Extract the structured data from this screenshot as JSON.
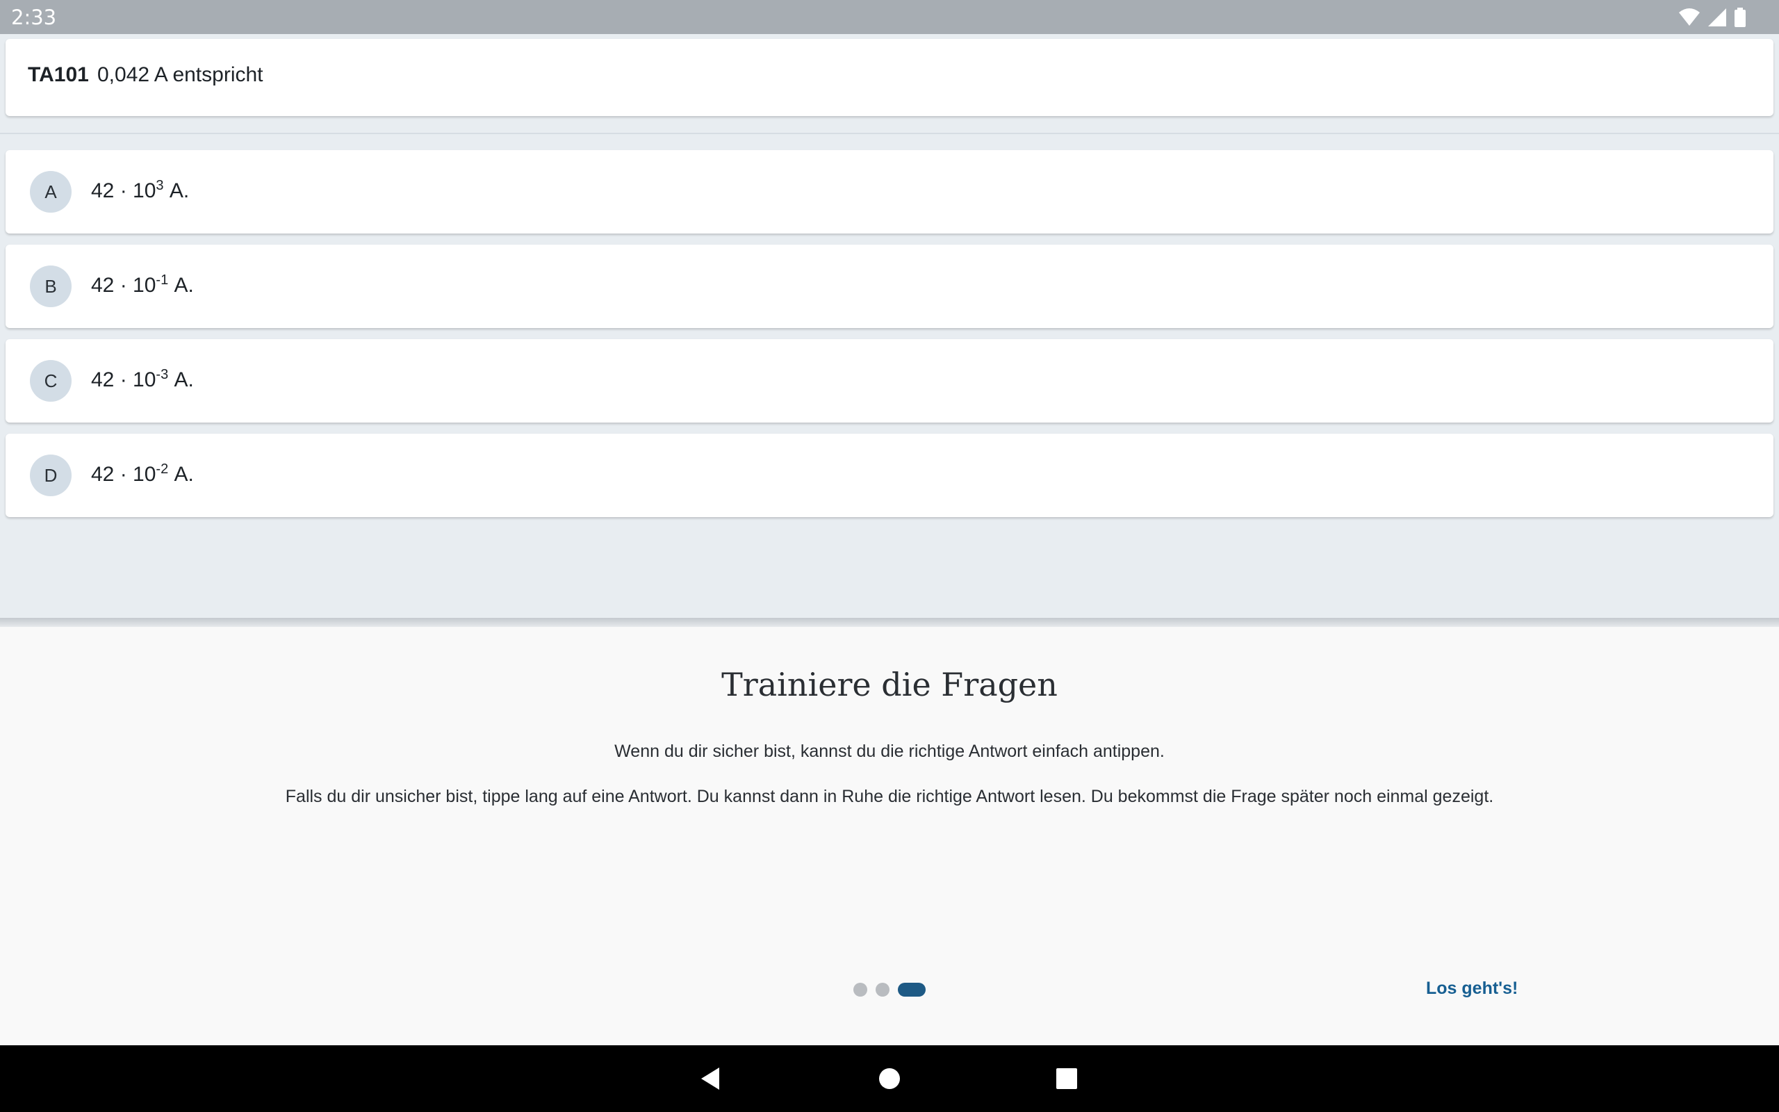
{
  "status_bar": {
    "time": "2:33",
    "icons": [
      "wifi-icon",
      "signal-icon",
      "battery-icon"
    ]
  },
  "question": {
    "id": "TA101",
    "text": "0,042 A entspricht"
  },
  "answers": [
    {
      "letter": "A",
      "base": "42 · 10",
      "exponent": "3",
      "unit": "A."
    },
    {
      "letter": "B",
      "base": "42 · 10",
      "exponent": "-1",
      "unit": "A."
    },
    {
      "letter": "C",
      "base": "42 · 10",
      "exponent": "-3",
      "unit": "A."
    },
    {
      "letter": "D",
      "base": "42 · 10",
      "exponent": "-2",
      "unit": "A."
    }
  ],
  "onboarding": {
    "title": "Trainiere die Fragen",
    "paragraph1": "Wenn du dir sicher bist, kannst du die richtige Antwort einfach antippen.",
    "paragraph2": "Falls du dir unsicher bist, tippe lang auf eine Antwort. Du kannst dann in Ruhe die richtige Antwort lesen. Du bekommst die Frage später noch einmal gezeigt.",
    "cta_label": "Los geht's!",
    "page_count": 3,
    "active_page": 3
  },
  "nav_bar": {
    "buttons": [
      "back-icon",
      "home-icon",
      "recents-icon"
    ]
  },
  "colors": {
    "status_bar": "#a7adb3",
    "background": "#e8edf1",
    "badge": "#d3dde6",
    "accent": "#1e5a85",
    "cta": "#175f92"
  }
}
